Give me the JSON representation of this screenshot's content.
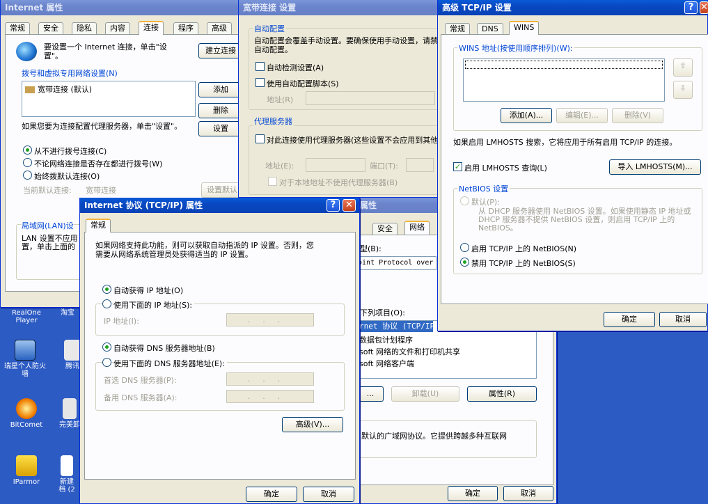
{
  "desktop": {
    "icons": [
      {
        "label": "RealOne\nPlayer"
      },
      {
        "label": "淘宝"
      },
      {
        "label": "瑞星个人防火\n墙"
      },
      {
        "label": "腾讯"
      },
      {
        "label": "BitComet"
      },
      {
        "label": "完美卸"
      },
      {
        "label": "IParmor"
      },
      {
        "label": "新建\n档 (2"
      }
    ]
  },
  "inet_props": {
    "title": "Internet 属性",
    "tabs": [
      "常规",
      "安全",
      "隐私",
      "内容",
      "连接",
      "程序",
      "高级"
    ],
    "setup_text": "要设置一个 Internet 连接，单击\"设置\"。",
    "setup_btn": "建立连接",
    "dialup_group": "拨号和虚拟专用网络设置",
    "dialup_shortcut": "(N)",
    "connection_item": "宽带连接 (默认)",
    "add_btn": "添加",
    "delete_btn": "删除",
    "settings_btn": "设置",
    "proxy_hint": "如果您要为连接配置代理服务器，单击\"设置\"。",
    "radio_never": "从不进行拨号连接(C)",
    "radio_whenever": "不论网络连接是否存在都进行拨号(W)",
    "radio_always": "始终拨默认连接(O)",
    "current_default_label": "当前默认连接:",
    "current_default_value": "宽带连接",
    "set_default_btn": "设置默认",
    "lan_group": "局域网(LAN)设",
    "lan_text_1": "LAN 设置不应用",
    "lan_text_2": "置，单击上面的"
  },
  "broadband": {
    "title": "宽带连接 设置",
    "auto_group": "自动配置",
    "auto_text": "自动配置会覆盖手动设置。要确保使用手动设置，请禁用自动配置。",
    "auto_detect": "自动检测设置(A)",
    "use_script": "使用自动配置脚本(S)",
    "address_label": "地址(R)",
    "proxy_group": "代理服务器",
    "use_proxy": "对此连接使用代理服务器(这些设置不会应用到其他连接)",
    "proxy_address": "地址(E):",
    "port": "端口(T):",
    "bypass_local": "对于本地地址不使用代理服务器(B)"
  },
  "conn_props": {
    "title": "属性",
    "tab_security": "安全",
    "tab_network": "网络",
    "line1": "型(B):",
    "line2": "oint Protocol over",
    "line3": "下列项目(O):",
    "item_tcpip": "rnet 协议 (TCP/IP)",
    "item_qos": "数据包计划程序",
    "item_share": "soft 网络的文件和打印机共享",
    "item_client": "soft 网络客户端",
    "btn_install": "...",
    "btn_uninstall": "卸载(U)",
    "btn_props": "属性(R)",
    "desc": "默认的广域网协议。它提供跨越多种互联网",
    "ok": "确定",
    "cancel": "取消"
  },
  "tcpip": {
    "title": "Internet 协议 (TCP/IP) 属性",
    "tab_general": "常规",
    "intro": "如果网络支持此功能，则可以获取自动指派的 IP 设置。否则，您需要从网络系统管理员处获得适当的 IP 设置。",
    "auto_ip": "自动获得 IP 地址(O)",
    "manual_ip": "使用下面的 IP 地址(S):",
    "ip_label": "IP 地址(I):",
    "auto_dns": "自动获得 DNS 服务器地址(B)",
    "manual_dns": "使用下面的 DNS 服务器地址(E):",
    "pref_dns": "首选 DNS 服务器(P):",
    "alt_dns": "备用 DNS 服务器(A):",
    "ip_dots": "...",
    "advanced_btn": "高级(V)...",
    "ok": "确定",
    "cancel": "取消"
  },
  "adv_tcpip": {
    "title": "高级 TCP/IP 设置",
    "tabs": [
      "常规",
      "DNS",
      "WINS"
    ],
    "wins_label": "WINS 地址(按使用顺序排列)(W):",
    "add_btn": "添加(A)...",
    "edit_btn": "编辑(E)...",
    "remove_btn": "删除(V)",
    "lmhosts_text": "如果启用 LMHOSTS 搜索，它将应用于所有启用 TCP/IP 的连接。",
    "enable_lmhosts": "启用 LMHOSTS 查询(L)",
    "import_btn": "导入 LMHOSTS(M)...",
    "netbios_group": "NetBIOS 设置",
    "default": "默认(P):",
    "default_desc": "从 DHCP 服务器使用 NetBIOS 设置。如果使用静态 IP 地址或 DHCP 服务器不提供 NetBIOS 设置，则启用 TCP/IP 上的 NetBIOS。",
    "enable_netbios": "启用 TCP/IP 上的 NetBIOS(N)",
    "disable_netbios": "禁用 TCP/IP 上的 NetBIOS(S)",
    "ok": "确定",
    "cancel": "取消"
  },
  "colors": {
    "titlebar": "#0a5ad8",
    "dialog": "#ece9d8",
    "desktop": "#2d5bc4"
  }
}
